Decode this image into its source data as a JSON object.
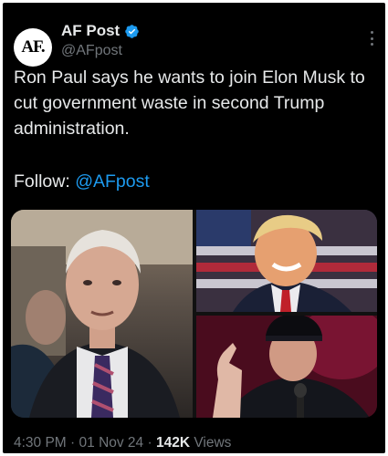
{
  "account": {
    "avatar_text": "AF.",
    "display_name": "AF Post",
    "handle": "@AFpost",
    "verified_color": "#1d9bf0"
  },
  "tweet": {
    "text": "Ron Paul says he wants to join Elon Musk to cut government waste in second Trump administration.",
    "follow_label": "Follow: ",
    "follow_link": "@AFpost"
  },
  "media": {
    "photos": [
      {
        "subject": "ron-paul-photo"
      },
      {
        "subject": "donald-trump-photo"
      },
      {
        "subject": "elon-musk-photo"
      }
    ]
  },
  "meta": {
    "time": "4:30 PM",
    "sep1": " · ",
    "date": "01 Nov 24",
    "sep2": " · ",
    "views_count": "142K",
    "views_label": " Views"
  },
  "colors": {
    "background": "#000000",
    "text": "#e7e9ea",
    "muted": "#71767b",
    "link": "#1d9bf0"
  }
}
